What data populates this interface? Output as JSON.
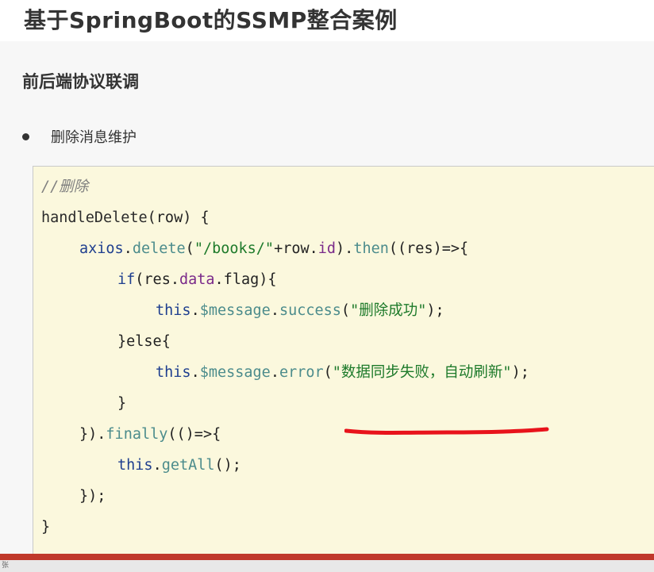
{
  "header": {
    "title": "基于SpringBoot的SSMP整合案例"
  },
  "content": {
    "section_heading": "前后端协议联调",
    "bullet": "删除消息维护"
  },
  "code": {
    "comment": "//删除",
    "l1_fn": "handleDelete",
    "l1_rest": "(row) {",
    "l2_axios": "axios",
    "l2_dot1": ".",
    "l2_delete": "delete",
    "l2_open": "(",
    "l2_str": "\"/books/\"",
    "l2_mid": "+row.",
    "l2_id": "id",
    "l2_close": ").",
    "l2_then": "then",
    "l2_rest": "((res)=>{",
    "l3_if": "if",
    "l3_open": "(res.",
    "l3_data": "data",
    "l3_rest": ".flag){",
    "l4_this": "this",
    "l4_dot": ".",
    "l4_msg": "$message",
    "l4_dot2": ".",
    "l4_success": "success",
    "l4_open": "(",
    "l4_str": "\"删除成功\"",
    "l4_close": ");",
    "l5_else": "}else{",
    "l6_this": "this",
    "l6_dot": ".",
    "l6_msg": "$message",
    "l6_dot2": ".",
    "l6_error": "error",
    "l6_open": "(",
    "l6_str": "\"数据同步失败，自动刷新\"",
    "l6_close": ");",
    "l7_close": "}",
    "l8_pre": "}).",
    "l8_finally": "finally",
    "l8_rest": "(()=>{",
    "l9_this": "this",
    "l9_dot": ".",
    "l9_getall": "getAll",
    "l9_rest": "();",
    "l10": "});",
    "l11": "}"
  },
  "status": {
    "char": "张"
  },
  "colors": {
    "accent_bar": "#c0392b",
    "code_bg": "#fbf8dd",
    "underline": "#e8131b"
  }
}
